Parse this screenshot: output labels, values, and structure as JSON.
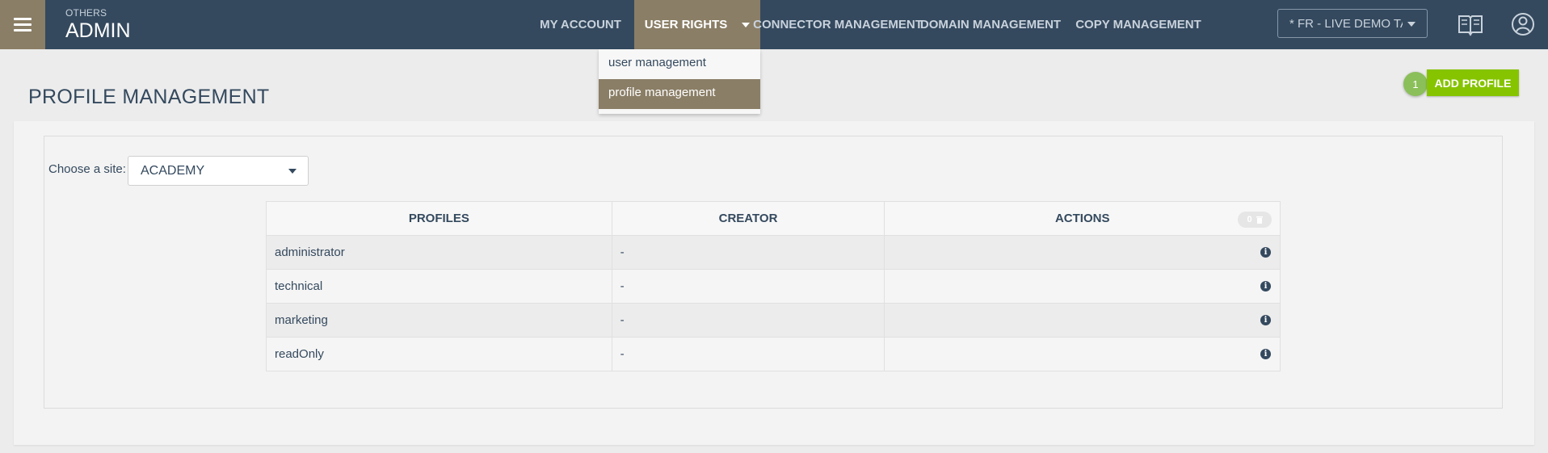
{
  "header": {
    "section_label": "OTHERS",
    "app_title": "ADMIN",
    "nav": [
      {
        "label": "MY ACCOUNT"
      },
      {
        "label": "USER RIGHTS"
      },
      {
        "label": "CONNECTOR MANAGEMENT"
      },
      {
        "label": "DOMAIN MANAGEMENT"
      },
      {
        "label": "COPY MANAGEMENT"
      }
    ],
    "site_selector": "* FR - LIVE DEMO TA",
    "icons": [
      "menu-icon",
      "book-icon",
      "user-icon"
    ]
  },
  "dropdown": {
    "items": [
      {
        "label": "user management"
      },
      {
        "label": "profile management",
        "selected": true
      }
    ]
  },
  "page": {
    "title": "PROFILE MANAGEMENT",
    "badge_count": "1",
    "add_button": "ADD PROFILE"
  },
  "filter": {
    "label": "Choose a site:",
    "value": "ACADEMY"
  },
  "table": {
    "headers": [
      "PROFILES",
      "CREATOR",
      "ACTIONS"
    ],
    "selected_count": "0",
    "rows": [
      {
        "profile": "administrator",
        "creator": "-"
      },
      {
        "profile": "technical",
        "creator": "-"
      },
      {
        "profile": "marketing",
        "creator": "-"
      },
      {
        "profile": "readOnly",
        "creator": "-"
      }
    ]
  },
  "colors": {
    "topbar": "#34495e",
    "accent": "#8a7e66",
    "add_button": "#86c400",
    "badge": "#8bbf5a"
  }
}
